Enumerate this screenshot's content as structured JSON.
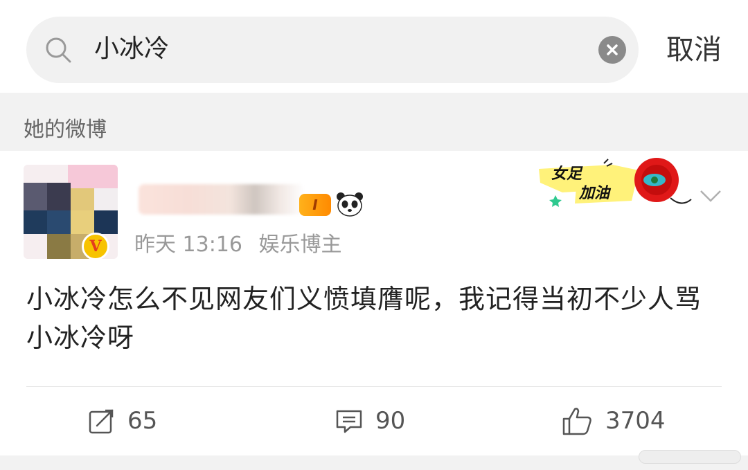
{
  "search": {
    "query": "小冰冷",
    "cancel_label": "取消"
  },
  "section": {
    "title": "她的微博"
  },
  "post": {
    "level_badge": "I",
    "time": "昨天 13:16",
    "user_tag": "娱乐博主",
    "sticker_text_1": "女足",
    "sticker_text_2": "加油",
    "verified_mark": "V",
    "text": "小冰冷怎么不见网友们义愤填膺呢，我记得当初不少人骂小冰冷呀",
    "actions": {
      "repost_count": "65",
      "comment_count": "90",
      "like_count": "3704"
    }
  },
  "colors": {
    "accent_orange": "#ff8a00",
    "badge_yellow": "#f7c300",
    "text_primary": "#222222",
    "text_secondary": "#999999"
  }
}
